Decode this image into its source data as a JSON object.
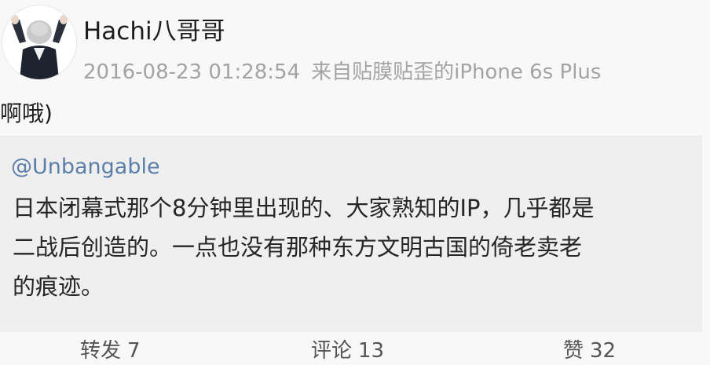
{
  "post": {
    "username": "Hachi八哥哥",
    "timestamp": "2016-08-23 01:28:54",
    "source": "来自贴膜贴歪的iPhone 6s Plus",
    "text": "啊哦)"
  },
  "retweet": {
    "mention": "@Unbangable",
    "lines": [
      "日本闭幕式那个8分钟里出现的、大家熟知的IP，几乎都是",
      "二战后创造的。一点也没有那种东方文明古国的倚老卖老",
      "的痕迹。"
    ]
  },
  "actions": {
    "repost": {
      "label": "转发",
      "count": "7"
    },
    "comment": {
      "label": "评论",
      "count": "13"
    },
    "like": {
      "label": "赞",
      "count": "32"
    }
  }
}
